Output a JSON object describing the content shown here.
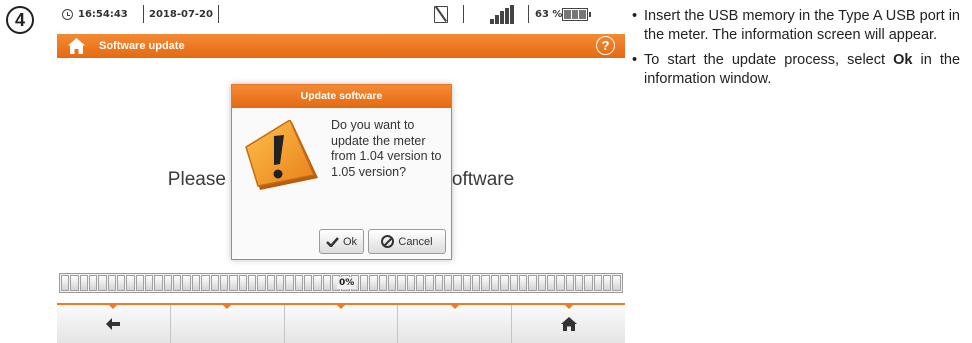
{
  "step_number": "4",
  "status_bar": {
    "time": "16:54:43",
    "date": "2018-07-20",
    "battery_percent": "63 %"
  },
  "title_bar": {
    "title": "Software update",
    "help_label": "?"
  },
  "main": {
    "message": "Please insert the media with the software",
    "progress_label": "0%",
    "progress_value": 0
  },
  "dialog": {
    "title": "Update software",
    "question": "Do you want to update the meter from 1.04 version to 1.05 version?",
    "ok_label": "Ok",
    "cancel_label": "Cancel"
  },
  "bottom_bar": {
    "tabs": [
      "back",
      "",
      "",
      "",
      "home"
    ]
  },
  "instructions": {
    "item1": "Insert the USB memory in the Type A USB port in the meter. The information screen will appear.",
    "item2_before": "To start the update process, select ",
    "item2_bold": "Ok",
    "item2_after": " in the information window."
  },
  "colors": {
    "accent": "#f07a22",
    "warning_icon": "#f59a2a"
  },
  "icons": [
    "clock-icon",
    "sim-card-crossed-icon",
    "signal-strength-icon",
    "battery-icon",
    "home-icon",
    "help-icon",
    "warning-icon",
    "check-icon",
    "cancel-icon",
    "back-arrow-icon"
  ]
}
